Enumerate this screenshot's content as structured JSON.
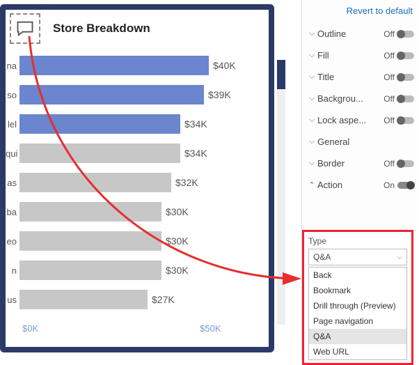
{
  "header": {
    "more_menu": "···",
    "title": "Store Breakdown"
  },
  "chart_data": {
    "type": "bar",
    "title": "Store Breakdown",
    "xlabel": "",
    "ylabel": "",
    "xlim": [
      0,
      50000
    ],
    "axis_ticks": [
      "$0K",
      "$50K"
    ],
    "categories": [
      "na",
      "so",
      "lel",
      "qui",
      "as",
      "ba",
      "eo",
      "n",
      "us"
    ],
    "values": [
      40000,
      39000,
      34000,
      34000,
      32000,
      30000,
      30000,
      30000,
      27000
    ],
    "labels": [
      "$40K",
      "$39K",
      "$34K",
      "$34K",
      "$32K",
      "$30K",
      "$30K",
      "$30K",
      "$27K"
    ],
    "highlighted_indices": [
      0,
      1,
      2
    ]
  },
  "right_panel": {
    "revert_label": "Revert to default",
    "rows": {
      "outline": {
        "label": "Outline",
        "state_label": "Off"
      },
      "fill": {
        "label": "Fill",
        "state_label": "Off"
      },
      "title": {
        "label": "Title",
        "state_label": "Off"
      },
      "background": {
        "label": "Backgrou...",
        "state_label": "Off"
      },
      "lockaspect": {
        "label": "Lock aspe...",
        "state_label": "Off"
      },
      "general": {
        "label": "General"
      },
      "border": {
        "label": "Border",
        "state_label": "Off"
      },
      "action": {
        "label": "Action",
        "state_label": "On"
      }
    }
  },
  "type_panel": {
    "label": "Type",
    "selected": "Q&A",
    "options": [
      "Back",
      "Bookmark",
      "Drill through (Preview)",
      "Page navigation",
      "Q&A",
      "Web URL"
    ]
  },
  "colors": {
    "accent_bar": "#6b86ce",
    "dim_bar": "#c7c7c7",
    "card_border": "#2b3a67",
    "highlight_box": "#e62e2e",
    "link": "#1c6fbb"
  }
}
